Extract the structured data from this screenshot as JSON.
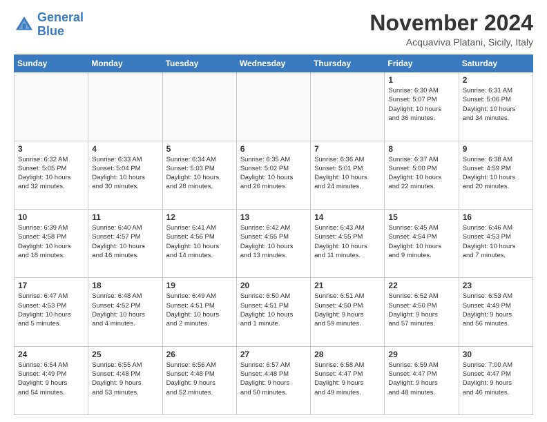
{
  "header": {
    "logo_line1": "General",
    "logo_line2": "Blue",
    "title": "November 2024",
    "location": "Acquaviva Platani, Sicily, Italy"
  },
  "weekdays": [
    "Sunday",
    "Monday",
    "Tuesday",
    "Wednesday",
    "Thursday",
    "Friday",
    "Saturday"
  ],
  "weeks": [
    [
      {
        "day": "",
        "info": ""
      },
      {
        "day": "",
        "info": ""
      },
      {
        "day": "",
        "info": ""
      },
      {
        "day": "",
        "info": ""
      },
      {
        "day": "",
        "info": ""
      },
      {
        "day": "1",
        "info": "Sunrise: 6:30 AM\nSunset: 5:07 PM\nDaylight: 10 hours\nand 36 minutes."
      },
      {
        "day": "2",
        "info": "Sunrise: 6:31 AM\nSunset: 5:06 PM\nDaylight: 10 hours\nand 34 minutes."
      }
    ],
    [
      {
        "day": "3",
        "info": "Sunrise: 6:32 AM\nSunset: 5:05 PM\nDaylight: 10 hours\nand 32 minutes."
      },
      {
        "day": "4",
        "info": "Sunrise: 6:33 AM\nSunset: 5:04 PM\nDaylight: 10 hours\nand 30 minutes."
      },
      {
        "day": "5",
        "info": "Sunrise: 6:34 AM\nSunset: 5:03 PM\nDaylight: 10 hours\nand 28 minutes."
      },
      {
        "day": "6",
        "info": "Sunrise: 6:35 AM\nSunset: 5:02 PM\nDaylight: 10 hours\nand 26 minutes."
      },
      {
        "day": "7",
        "info": "Sunrise: 6:36 AM\nSunset: 5:01 PM\nDaylight: 10 hours\nand 24 minutes."
      },
      {
        "day": "8",
        "info": "Sunrise: 6:37 AM\nSunset: 5:00 PM\nDaylight: 10 hours\nand 22 minutes."
      },
      {
        "day": "9",
        "info": "Sunrise: 6:38 AM\nSunset: 4:59 PM\nDaylight: 10 hours\nand 20 minutes."
      }
    ],
    [
      {
        "day": "10",
        "info": "Sunrise: 6:39 AM\nSunset: 4:58 PM\nDaylight: 10 hours\nand 18 minutes."
      },
      {
        "day": "11",
        "info": "Sunrise: 6:40 AM\nSunset: 4:57 PM\nDaylight: 10 hours\nand 16 minutes."
      },
      {
        "day": "12",
        "info": "Sunrise: 6:41 AM\nSunset: 4:56 PM\nDaylight: 10 hours\nand 14 minutes."
      },
      {
        "day": "13",
        "info": "Sunrise: 6:42 AM\nSunset: 4:55 PM\nDaylight: 10 hours\nand 13 minutes."
      },
      {
        "day": "14",
        "info": "Sunrise: 6:43 AM\nSunset: 4:55 PM\nDaylight: 10 hours\nand 11 minutes."
      },
      {
        "day": "15",
        "info": "Sunrise: 6:45 AM\nSunset: 4:54 PM\nDaylight: 10 hours\nand 9 minutes."
      },
      {
        "day": "16",
        "info": "Sunrise: 6:46 AM\nSunset: 4:53 PM\nDaylight: 10 hours\nand 7 minutes."
      }
    ],
    [
      {
        "day": "17",
        "info": "Sunrise: 6:47 AM\nSunset: 4:53 PM\nDaylight: 10 hours\nand 5 minutes."
      },
      {
        "day": "18",
        "info": "Sunrise: 6:48 AM\nSunset: 4:52 PM\nDaylight: 10 hours\nand 4 minutes."
      },
      {
        "day": "19",
        "info": "Sunrise: 6:49 AM\nSunset: 4:51 PM\nDaylight: 10 hours\nand 2 minutes."
      },
      {
        "day": "20",
        "info": "Sunrise: 6:50 AM\nSunset: 4:51 PM\nDaylight: 10 hours\nand 1 minute."
      },
      {
        "day": "21",
        "info": "Sunrise: 6:51 AM\nSunset: 4:50 PM\nDaylight: 9 hours\nand 59 minutes."
      },
      {
        "day": "22",
        "info": "Sunrise: 6:52 AM\nSunset: 4:50 PM\nDaylight: 9 hours\nand 57 minutes."
      },
      {
        "day": "23",
        "info": "Sunrise: 6:53 AM\nSunset: 4:49 PM\nDaylight: 9 hours\nand 56 minutes."
      }
    ],
    [
      {
        "day": "24",
        "info": "Sunrise: 6:54 AM\nSunset: 4:49 PM\nDaylight: 9 hours\nand 54 minutes."
      },
      {
        "day": "25",
        "info": "Sunrise: 6:55 AM\nSunset: 4:48 PM\nDaylight: 9 hours\nand 53 minutes."
      },
      {
        "day": "26",
        "info": "Sunrise: 6:56 AM\nSunset: 4:48 PM\nDaylight: 9 hours\nand 52 minutes."
      },
      {
        "day": "27",
        "info": "Sunrise: 6:57 AM\nSunset: 4:48 PM\nDaylight: 9 hours\nand 50 minutes."
      },
      {
        "day": "28",
        "info": "Sunrise: 6:58 AM\nSunset: 4:47 PM\nDaylight: 9 hours\nand 49 minutes."
      },
      {
        "day": "29",
        "info": "Sunrise: 6:59 AM\nSunset: 4:47 PM\nDaylight: 9 hours\nand 48 minutes."
      },
      {
        "day": "30",
        "info": "Sunrise: 7:00 AM\nSunset: 4:47 PM\nDaylight: 9 hours\nand 46 minutes."
      }
    ]
  ]
}
